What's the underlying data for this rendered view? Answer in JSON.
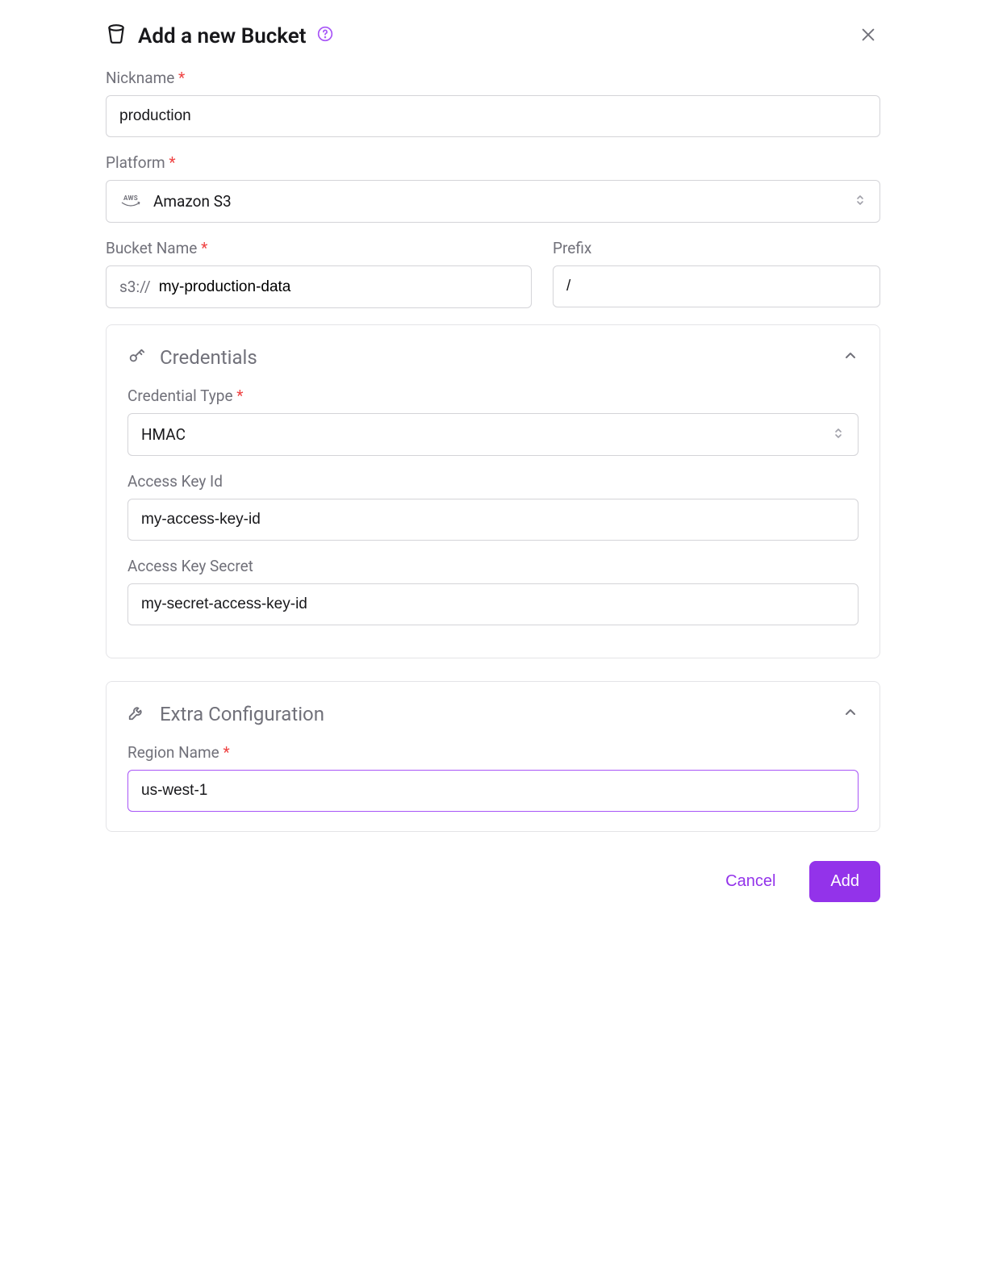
{
  "header": {
    "title": "Add a new Bucket"
  },
  "nickname": {
    "label": "Nickname",
    "value": "production"
  },
  "platform": {
    "label": "Platform",
    "aws_text": "AWS",
    "value": "Amazon S3"
  },
  "bucket": {
    "label": "Bucket Name",
    "scheme": "s3://",
    "value": "my-production-data"
  },
  "prefix": {
    "label": "Prefix",
    "value": "/"
  },
  "credentials": {
    "title": "Credentials",
    "type_label": "Credential Type",
    "type_value": "HMAC",
    "key_id_label": "Access Key Id",
    "key_id_value": "my-access-key-id",
    "key_secret_label": "Access Key Secret",
    "key_secret_value": "my-secret-access-key-id"
  },
  "extra": {
    "title": "Extra Configuration",
    "region_label": "Region Name",
    "region_value": "us-west-1"
  },
  "footer": {
    "cancel": "Cancel",
    "add": "Add"
  }
}
